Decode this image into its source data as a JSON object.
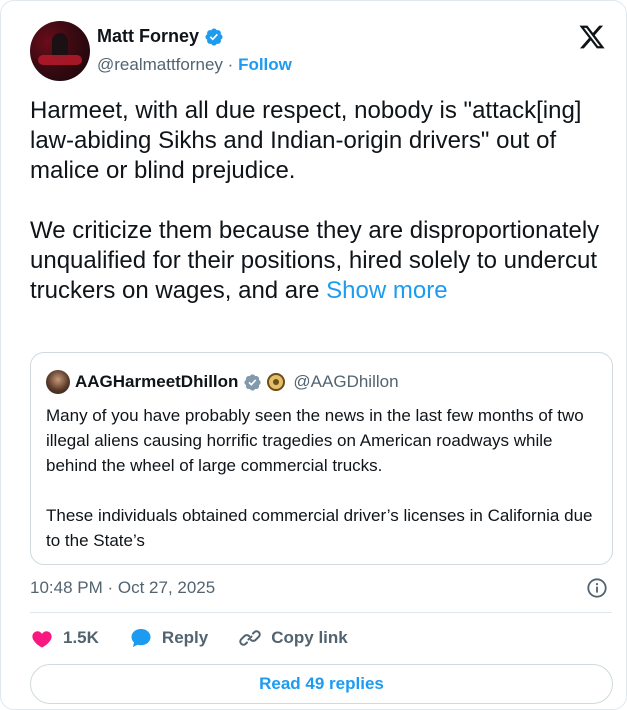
{
  "author": {
    "display_name": "Matt Forney",
    "handle": "@realmattforney",
    "separator": "·",
    "follow_label": "Follow"
  },
  "tweet": {
    "text": "Harmeet, with all due respect, nobody is \"attack[ing] law-abiding Sikhs and Indian-origin drivers\" out of malice or blind prejudice.\n\nWe criticize them because they are disproportionately unqualified for their positions, hired solely to undercut truckers on wages, and are ",
    "show_more": "Show more"
  },
  "quoted": {
    "display_name": "AAGHarmeetDhillon",
    "handle": "@AAGDhillon",
    "text": "Many of you have probably seen the news in the last few months of two illegal aliens causing horrific tragedies on American roadways while behind the wheel of large commercial trucks.\n\nThese individuals obtained commercial driver’s licenses in California due to the State’s"
  },
  "timestamp": "10:48 PM · Oct 27, 2025",
  "actions": {
    "like_count": "1.5K",
    "reply_label": "Reply",
    "copy_link_label": "Copy link"
  },
  "read_replies_label": "Read 49 replies",
  "colors": {
    "accent": "#1d9bf0",
    "like": "#f91880",
    "text": "#0f1419",
    "secondary": "#536471"
  },
  "icons": [
    "verified-badge-icon",
    "x-logo-icon",
    "info-icon",
    "heart-icon",
    "reply-bubble-icon",
    "link-icon",
    "government-seal-icon"
  ]
}
